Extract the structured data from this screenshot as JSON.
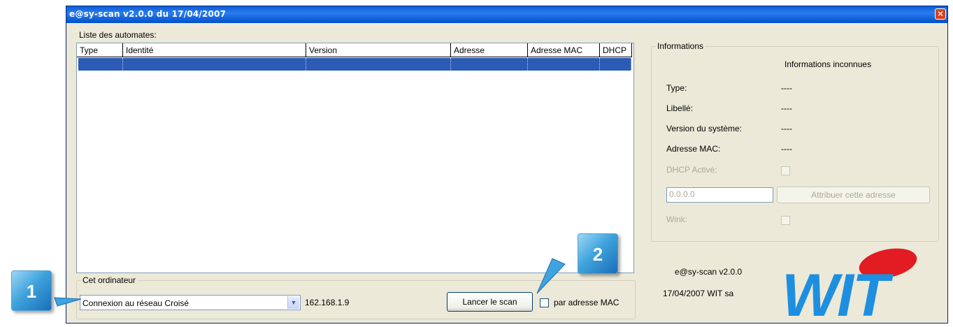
{
  "window": {
    "title": "e@sy-scan v2.0.0 du 17/04/2007",
    "close_glyph": "✕"
  },
  "list": {
    "label": "Liste des automates:",
    "columns": [
      "Type",
      "Identité",
      "Version",
      "Adresse",
      "Adresse MAC",
      "DHCP"
    ]
  },
  "computer": {
    "group_label": "Cet ordinateur",
    "connection_value": "Connexion au réseau Croisé",
    "ip_address": "162.168.1.9",
    "scan_button": "Lancer le scan",
    "mac_checkbox_label": "par adresse MAC"
  },
  "info": {
    "group_label": "Informations",
    "status": "Informations inconnues",
    "type_label": "Type:",
    "type_value": "----",
    "libelle_label": "Libellé:",
    "libelle_value": "----",
    "version_label": "Version du système:",
    "version_value": "----",
    "mac_label": "Adresse MAC:",
    "mac_value": "----",
    "dhcp_label": "DHCP Activé:",
    "ip_field_value": "0.0.0.0",
    "assign_button": "Attribuer cette adresse",
    "wink_label": "Wink:"
  },
  "about": {
    "version": "e@sy-scan v2.0.0",
    "date_company": "17/04/2007 WIT sa",
    "logo_text": "WIT"
  },
  "callouts": {
    "first": "1",
    "second": "2"
  },
  "colors": {
    "title_bar": "#0a5fd8",
    "selection": "#2b5bb5",
    "logo_blue": "#1e8fe0",
    "logo_red": "#e31b23"
  }
}
